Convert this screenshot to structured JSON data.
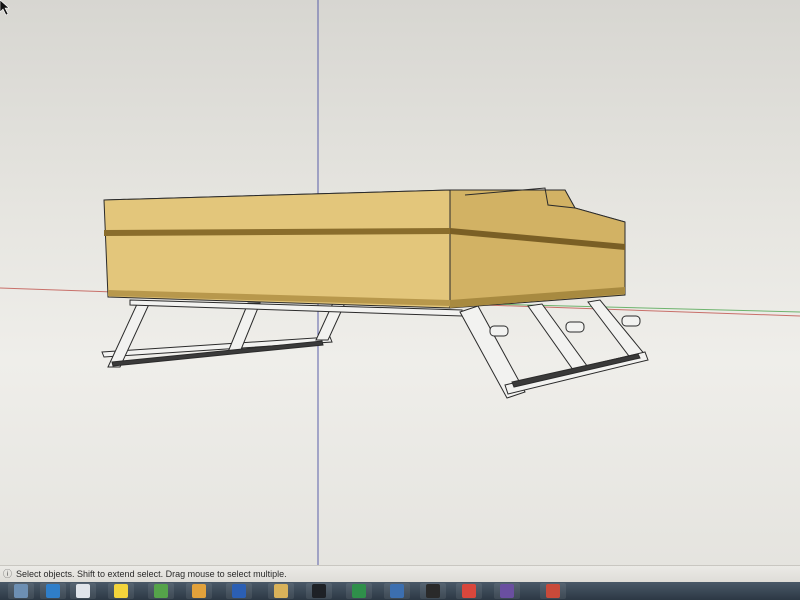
{
  "app": {
    "status_text": "Select objects. Shift to extend select. Drag mouse to select multiple."
  },
  "colors": {
    "box_front": "#e3c67b",
    "box_side": "#d2b264",
    "box_stripe": "#8a6d2c",
    "frame": "#f2f2f0",
    "axis_red": "#c8706a",
    "axis_green": "#6fb46e",
    "axis_blue": "#5a5fa8",
    "taskbar": "#34414e"
  },
  "taskbar": {
    "items": [
      {
        "name": "start-orb-icon",
        "color": "#6d8fb3"
      },
      {
        "name": "media-player-icon",
        "color": "#2f7ec9"
      },
      {
        "name": "cloud-app-icon",
        "color": "#e0e4ea"
      },
      {
        "name": "sunflower-app-icon",
        "color": "#f4d43b"
      },
      {
        "name": "green-app-icon",
        "color": "#55a34a"
      },
      {
        "name": "outlook-icon",
        "color": "#e3a23b"
      },
      {
        "name": "word-icon",
        "color": "#2b5fb4"
      },
      {
        "name": "explorer-icon",
        "color": "#d9b25a"
      },
      {
        "name": "terminal-icon",
        "color": "#1e2126"
      },
      {
        "name": "excel-icon",
        "color": "#2f8f4a"
      },
      {
        "name": "media-icon",
        "color": "#3c6fb0"
      },
      {
        "name": "pycharm-icon",
        "color": "#2a2a2a"
      },
      {
        "name": "chrome-icon",
        "color": "#d9473c"
      },
      {
        "name": "app-icon",
        "color": "#6a4fa0"
      },
      {
        "name": "folder-icon",
        "color": "#c94a3a"
      }
    ]
  }
}
